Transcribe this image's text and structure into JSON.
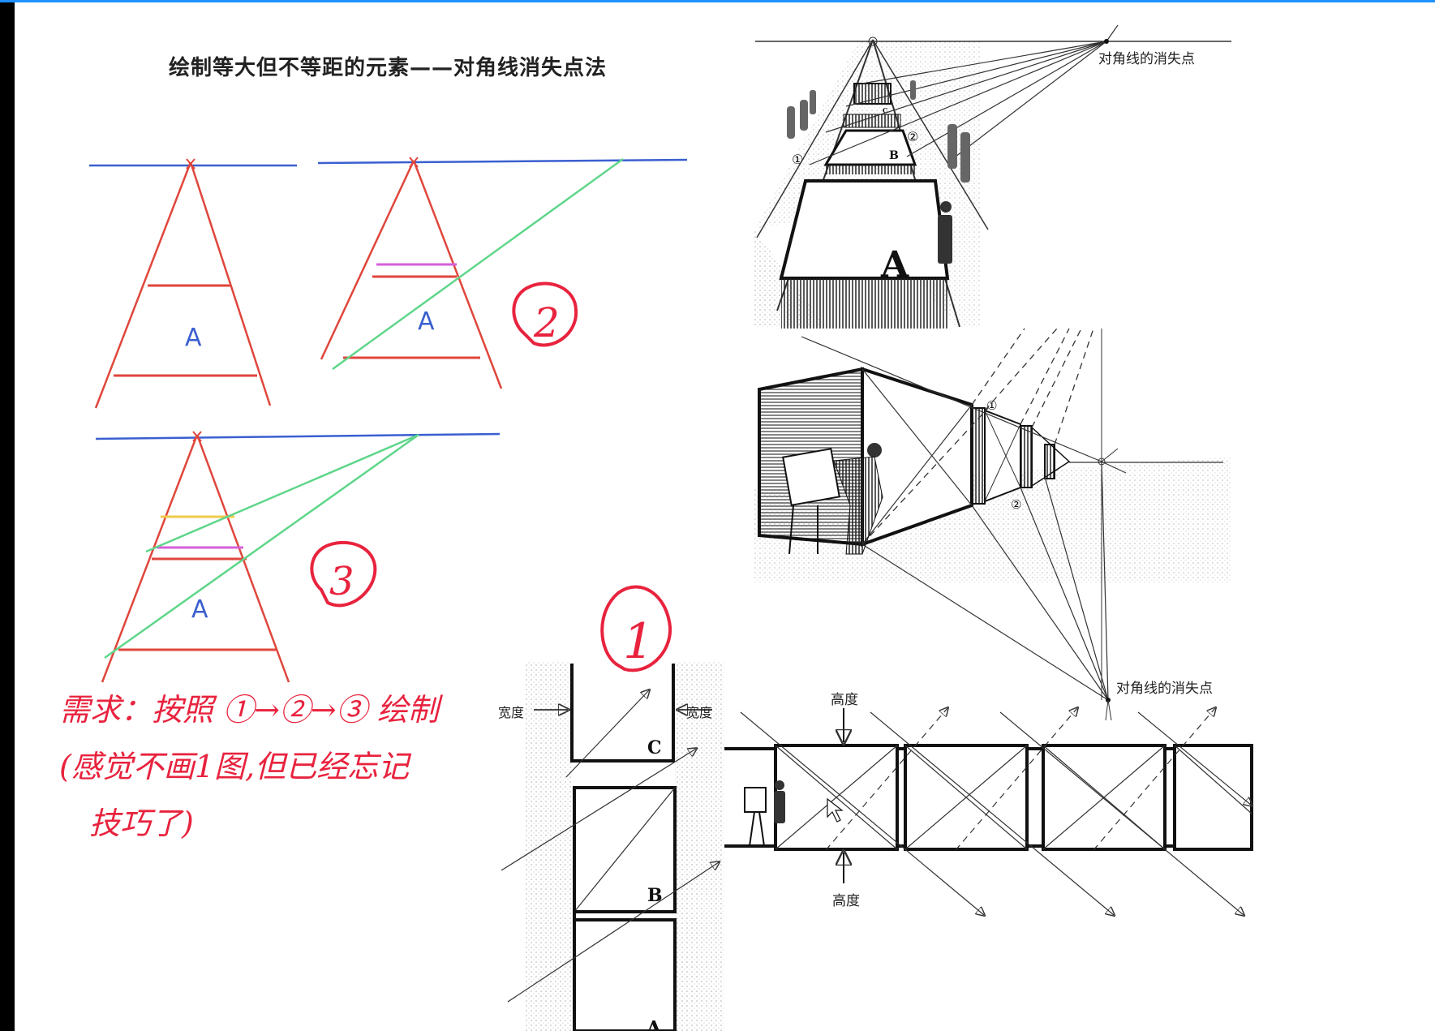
{
  "page": {
    "title": "绘制等大但不等距的元素——对角线消失点法"
  },
  "left_sketches": {
    "panel_a_letter": "A",
    "panel_b_letter": "A",
    "panel_c_letter": "A",
    "step_mark_2": "2",
    "step_mark_3": "3",
    "step_mark_1": "1"
  },
  "colors": {
    "horizon": "#3a5fd0",
    "perspective_lines": "#e0463c",
    "diagonal": "#5fd68a",
    "magenta": "#d65fd8",
    "yellow": "#f0c94a",
    "annotation": "#e8233e"
  },
  "note": {
    "line1": "需求：按照 ①→②→③ 绘制",
    "line2": "(感觉不画1图,但已经忘记",
    "line3": "技巧了)"
  },
  "right_figures": {
    "fig_top_label": "对角线的消失点",
    "fig_top_markers": [
      "①",
      "②"
    ],
    "fig_top_letters": [
      "A",
      "B",
      "C"
    ],
    "fig_mid_markers": [
      "①",
      "②"
    ],
    "fig_mid_label": "对角线的消失点",
    "fig_plan_width_left": "宽度",
    "fig_plan_width_right": "宽度",
    "fig_plan_letters": [
      "C",
      "B",
      "A"
    ],
    "fig_elev_height_top": "高度",
    "fig_elev_height_bottom": "高度"
  }
}
